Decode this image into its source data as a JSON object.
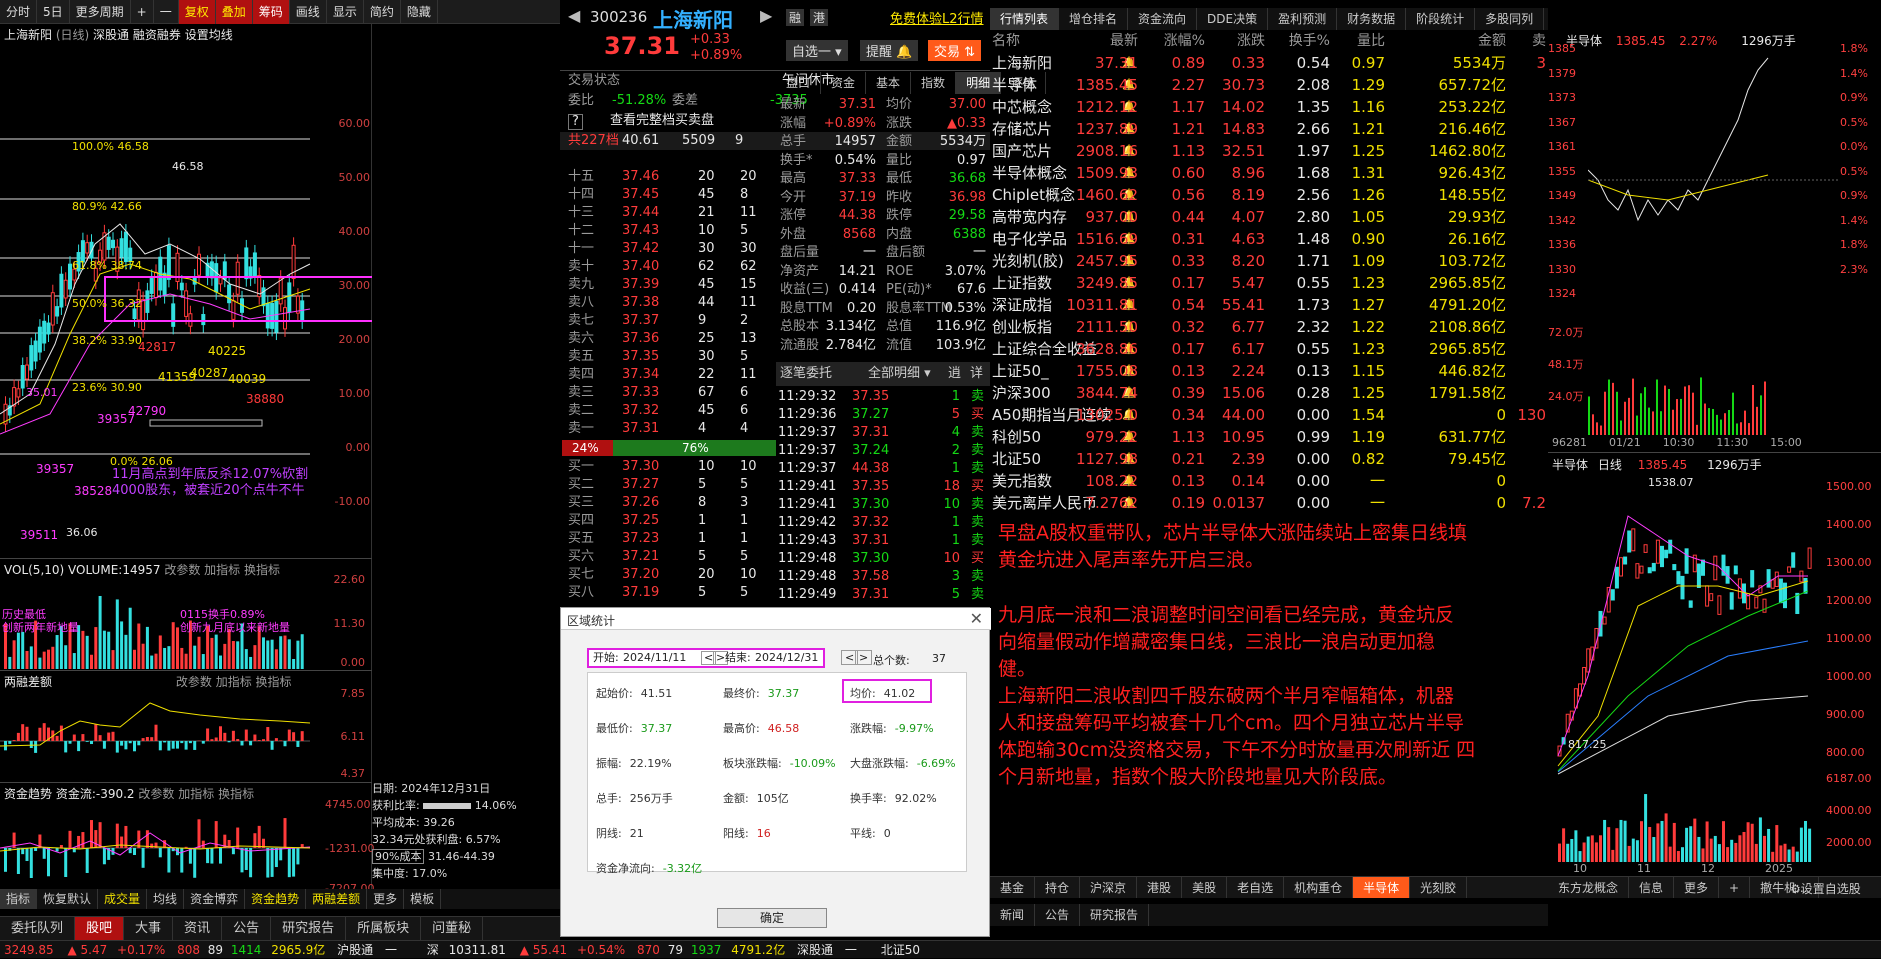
{
  "toolbar": {
    "items": [
      "分时",
      "5日",
      "更多周期",
      "+",
      "一",
      "复权",
      "叠加",
      "筹码",
      "画线",
      "显示",
      "简约",
      "隐藏"
    ]
  },
  "chart": {
    "stock_name": "上海新阳",
    "period": "(日线)",
    "tags": [
      "深股通",
      "融资融券",
      "设置均线"
    ],
    "price_axis": [
      "60.00",
      "50.00",
      "40.00",
      "30.00",
      "20.00",
      "10.00",
      "0.00",
      "-10.00"
    ],
    "fib": [
      "100.0% 46.58",
      "80.9% 42.66",
      "61.8% 38.74",
      "50.0% 36.32",
      "38.2% 33.90",
      "23.6% 30.90",
      "0.0% 26.06"
    ],
    "price_marks": [
      "46.58",
      "42817",
      "40225",
      "41359",
      "40287",
      "40039",
      "38880",
      "42790",
      "39357",
      "38528",
      "39357",
      "39511",
      "35.01",
      "36.06"
    ],
    "annotation": [
      "11月高点到年底反杀12.07%砍割",
      "4000股东，被套近20个点牛不牛"
    ],
    "x_axis": [
      "09",
      "10",
      "11",
      "12",
      "2025"
    ],
    "vol_header": "VOL(5,10)  VOLUME:14957",
    "vol_axis": [
      "22.60",
      "11.30",
      "0.00"
    ],
    "vol_notes": [
      "历史最低",
      "创新两年新地量",
      "0115换手0.89%",
      "创新九月底以来新地量"
    ],
    "margin_header": "两融差额",
    "margin_axis": [
      "7.85",
      "6.11",
      "4.37"
    ],
    "fund_header": "资金趋势  资金流:-390.2",
    "fund_axis": [
      "4745.00",
      "-1231.00",
      "-7207.00"
    ],
    "pane_btns": [
      "改参数",
      "加指标",
      "换指标"
    ],
    "chip": {
      "date": "日期: 2024年12月31日",
      "profit_ratio": "获利比率:",
      "profit_val": "14.06%",
      "avg_cost": "平均成本: 39.26",
      "profit_line": "32.34元处获利盘: 6.57%",
      "cost90": "90%成本",
      "cost90_range": "31.46-44.39",
      "concentration": "集中度: 17.0%"
    },
    "bottom_btns": [
      "指标",
      "恢复默认",
      "成交量",
      "均线",
      "资金博弈",
      "资金趋势",
      "两融差额",
      "更多",
      "模板"
    ]
  },
  "stock": {
    "code": "300236",
    "name": "上海新阳",
    "badges": [
      "融",
      "港"
    ],
    "l2": "免费体验L2行情",
    "price": "37.31",
    "change": "+0.33",
    "pct": "+0.89%",
    "btns": [
      "自选一",
      "提醒",
      "交易"
    ],
    "status_l": "交易状态",
    "status_r": "午间休市",
    "weibi": "委比",
    "weibi_v": "-51.28%",
    "weicha": "委差",
    "weicha_v": "-3735",
    "view_all": "查看完整档买卖盘",
    "total": "共227档",
    "total_p": "40.61",
    "total_v": "5509",
    "total_n": "9",
    "asks": [
      [
        "十五",
        "37.46",
        "20",
        "20"
      ],
      [
        "十四",
        "37.45",
        "45",
        "8"
      ],
      [
        "十三",
        "37.44",
        "21",
        "11"
      ],
      [
        "十二",
        "37.43",
        "10",
        "5"
      ],
      [
        "十一",
        "37.42",
        "30",
        "30"
      ],
      [
        "卖十",
        "37.40",
        "62",
        "62"
      ],
      [
        "卖九",
        "37.39",
        "45",
        "15"
      ],
      [
        "卖八",
        "37.38",
        "44",
        "11"
      ],
      [
        "卖七",
        "37.37",
        "9",
        "2"
      ],
      [
        "卖六",
        "37.36",
        "25",
        "13"
      ],
      [
        "卖五",
        "37.35",
        "30",
        "5"
      ],
      [
        "卖四",
        "37.34",
        "22",
        "11"
      ],
      [
        "卖三",
        "37.33",
        "67",
        "6"
      ],
      [
        "卖二",
        "37.32",
        "45",
        "6"
      ],
      [
        "卖一",
        "37.31",
        "4",
        "4"
      ]
    ],
    "bar_l": "24%",
    "bar_r": "76%",
    "bids": [
      [
        "买一",
        "37.30",
        "10",
        "10"
      ],
      [
        "买二",
        "37.27",
        "5",
        "5"
      ],
      [
        "买三",
        "37.26",
        "8",
        "3"
      ],
      [
        "买四",
        "37.25",
        "1",
        "1"
      ],
      [
        "买五",
        "37.23",
        "1",
        "1"
      ],
      [
        "买六",
        "37.21",
        "5",
        "5"
      ],
      [
        "买七",
        "37.20",
        "20",
        "10"
      ],
      [
        "买八",
        "37.19",
        "5",
        "5"
      ]
    ],
    "tabs": [
      "盘口",
      "资金",
      "基本",
      "指数",
      "明细",
      "逐笔"
    ],
    "quote": [
      [
        "最新",
        "37.31",
        "均价",
        "37.00"
      ],
      [
        "涨幅",
        "+0.89%",
        "涨跌",
        "▲0.33"
      ],
      [
        "总手",
        "14957",
        "金额",
        "5534万"
      ],
      [
        "换手*",
        "0.54%",
        "量比",
        "0.97"
      ],
      [
        "最高",
        "37.33",
        "最低",
        "36.68"
      ],
      [
        "今开",
        "37.19",
        "昨收",
        "36.98"
      ],
      [
        "涨停",
        "44.38",
        "跌停",
        "29.58"
      ],
      [
        "外盘",
        "8568",
        "内盘",
        "6388"
      ],
      [
        "盘后量",
        "一",
        "盘后额",
        "一"
      ],
      [
        "净资产",
        "14.21",
        "ROE",
        "3.07%"
      ],
      [
        "收益(三)",
        "0.414",
        "PE(动)*",
        "67.6"
      ],
      [
        "股息TTM",
        "0.20",
        "股息率TTM",
        "0.53%"
      ],
      [
        "总股本",
        "3.134亿",
        "总值",
        "116.9亿"
      ],
      [
        "流通股",
        "2.784亿",
        "流值",
        "103.9亿"
      ]
    ],
    "ticks_hdr": [
      "逐笔委托",
      "全部明细",
      "逍",
      "详"
    ],
    "ticks": [
      [
        "11:29:32",
        "37.35",
        "1",
        "卖"
      ],
      [
        "11:29:36",
        "37.27",
        "5",
        "买"
      ],
      [
        "11:29:37",
        "37.31",
        "4",
        "卖"
      ],
      [
        "11:29:37",
        "37.24",
        "2",
        "卖"
      ],
      [
        "11:29:37",
        "44.38",
        "1",
        "卖"
      ],
      [
        "11:29:41",
        "37.35",
        "18",
        "买"
      ],
      [
        "11:29:41",
        "37.30",
        "10",
        "卖"
      ],
      [
        "11:29:42",
        "37.32",
        "1",
        "卖"
      ],
      [
        "11:29:43",
        "37.31",
        "1",
        "卖"
      ],
      [
        "11:29:48",
        "37.30",
        "10",
        "买"
      ],
      [
        "11:29:48",
        "37.58",
        "3",
        "卖"
      ],
      [
        "11:29:49",
        "37.31",
        "5",
        "卖"
      ]
    ]
  },
  "dialog": {
    "title": "区域统计",
    "start_l": "开始:",
    "start": "2024/11/11",
    "end_l": "结束:",
    "end": "2024/12/31",
    "count_l": "总个数:",
    "count": "37",
    "cells": [
      [
        "起始价:",
        "41.51"
      ],
      [
        "最终价:",
        "37.37"
      ],
      [
        "均价:",
        "41.02"
      ],
      [
        "最低价:",
        "37.37"
      ],
      [
        "最高价:",
        "46.58"
      ],
      [
        "涨跌幅:",
        "-9.97%"
      ],
      [
        "振幅:",
        "22.19%"
      ],
      [
        "板块涨跌幅:",
        "-10.09%"
      ],
      [
        "大盘涨跌幅:",
        "-6.69%"
      ],
      [
        "总手:",
        "256万手"
      ],
      [
        "金额:",
        "105亿"
      ],
      [
        "换手率:",
        "92.02%"
      ],
      [
        "阴线:",
        "21"
      ],
      [
        "阳线:",
        "16"
      ],
      [
        "平线:",
        "0"
      ],
      [
        "资金净流向:",
        "-3.32亿"
      ]
    ],
    "ok": "确定"
  },
  "market": {
    "tabs": [
      "行情列表",
      "增仓排名",
      "资金流向",
      "DDE决策",
      "盈利预测",
      "财务数据",
      "阶段统计",
      "多股同列"
    ],
    "cols": [
      "名称",
      "最新",
      "涨幅%",
      "涨跌",
      "换手%",
      "量比",
      "金额",
      "卖"
    ],
    "rows": [
      [
        "上海新阳",
        "37.31",
        "0.89",
        "0.33",
        "0.54",
        "0.97",
        "5534万",
        "3"
      ],
      [
        "半导体",
        "1385.45",
        "2.27",
        "30.73",
        "2.08",
        "1.29",
        "657.72亿",
        ""
      ],
      [
        "中芯概念",
        "1212.12",
        "1.17",
        "14.02",
        "1.35",
        "1.16",
        "253.22亿",
        ""
      ],
      [
        "存储芯片",
        "1237.89",
        "1.21",
        "14.83",
        "2.66",
        "1.21",
        "216.46亿",
        ""
      ],
      [
        "国产芯片",
        "2908.16",
        "1.13",
        "32.51",
        "1.97",
        "1.25",
        "1462.80亿",
        ""
      ],
      [
        "半导体概念",
        "1509.93",
        "0.60",
        "8.96",
        "1.68",
        "1.31",
        "926.43亿",
        ""
      ],
      [
        "Chiplet概念",
        "1460.62",
        "0.56",
        "8.19",
        "2.56",
        "1.26",
        "148.55亿",
        ""
      ],
      [
        "高带宽内存",
        "937.00",
        "0.44",
        "4.07",
        "2.80",
        "1.05",
        "29.93亿",
        ""
      ],
      [
        "电子化学品",
        "1516.69",
        "0.31",
        "4.63",
        "1.48",
        "0.90",
        "26.16亿",
        ""
      ],
      [
        "光刻机(胶)",
        "2457.95",
        "0.33",
        "8.20",
        "1.71",
        "1.09",
        "103.72亿",
        ""
      ],
      [
        "上证指数",
        "3249.85",
        "0.17",
        "5.47",
        "0.55",
        "1.23",
        "2965.85亿",
        ""
      ],
      [
        "深证成指",
        "10311.81",
        "0.54",
        "55.41",
        "1.73",
        "1.27",
        "4791.20亿",
        ""
      ],
      [
        "创业板指",
        "2111.50",
        "0.32",
        "6.77",
        "2.32",
        "1.22",
        "2108.86亿",
        ""
      ],
      [
        "上证综合全收益",
        "3628.86",
        "0.17",
        "6.17",
        "0.55",
        "1.23",
        "2965.85亿",
        ""
      ],
      [
        "上证50_",
        "1755.08",
        "0.13",
        "2.24",
        "0.13",
        "1.15",
        "446.82亿",
        ""
      ],
      [
        "沪深300",
        "3844.74",
        "0.39",
        "15.06",
        "0.28",
        "1.25",
        "1791.58亿",
        ""
      ],
      [
        "A50期指当月连续",
        "13025.0",
        "0.34",
        "44.00",
        "0.00",
        "1.54",
        "0",
        "130"
      ],
      [
        "科创50",
        "979.22",
        "1.13",
        "10.95",
        "0.99",
        "1.19",
        "631.77亿",
        ""
      ],
      [
        "北证50",
        "1127.98",
        "0.21",
        "2.39",
        "0.00",
        "0.82",
        "79.45亿",
        ""
      ],
      [
        "美元指数",
        "108.22",
        "0.13",
        "0.14",
        "0.00",
        "一",
        "0",
        ""
      ],
      [
        "美元离岸人民币",
        "7.2762",
        "0.19",
        "0.0137",
        "0.00",
        "一",
        "0",
        "7.2"
      ]
    ],
    "note1": [
      "早盘A股权重带队，芯片半导体大涨陆续站上密集日线填",
      "黄金坑进入尾声率先开启三浪。"
    ],
    "note2": [
      "九月底一浪和二浪调整时间空间看已经完成，黄金坑反",
      "向缩量假动作增藏密集日线，三浪比一浪启动更加稳",
      "健。",
      "上海新阳二浪收割四千股东破两个半月窄幅箱体，机器",
      "人和接盘筹码平均被套十几个cm。四个月独立芯片半导",
      "体跑输30cm没资格交易，下午不分时放量再次刷新近 四",
      "个月新地量，指数个股大阶段地量见大阶段底。"
    ],
    "bottom_tabs": [
      "基金",
      "持仓",
      "沪深京",
      "港股",
      "美股",
      "老自选",
      "机构重仓",
      "半导体",
      "光刻胶",
      "东方龙概念",
      "信息",
      "更多",
      "+",
      "撤牛机..."
    ],
    "settings": "设置自选股",
    "news_tabs": [
      "新闻",
      "公告",
      "研究报告"
    ]
  },
  "right": {
    "top_hdr": [
      "半导体",
      "1385.45",
      "2.27%",
      "1296万手"
    ],
    "top_axis_l": [
      "1385",
      "1379",
      "1373",
      "1367",
      "1361",
      "1355",
      "1349",
      "1342",
      "1336",
      "1330",
      "1324"
    ],
    "top_axis_r": [
      "1.8%",
      "1.4%",
      "0.9%",
      "0.5%",
      "0.0%",
      "0.5%",
      "0.9%",
      "1.4%",
      "1.8%",
      "2.3%"
    ],
    "vol_axis": [
      "72.0万",
      "48.1万",
      "24.0万"
    ],
    "time_axis": [
      "96281",
      "01/21",
      "10:30",
      "11:30",
      "15:00"
    ],
    "k_hdr": [
      "半导体",
      "日线",
      "1385.45",
      "1296万手"
    ],
    "k_axis": [
      "1500.00",
      "1400.00",
      "1300.00",
      "1200.00",
      "1100.00",
      "1000.00",
      "900.00",
      "800.00"
    ],
    "k_marks": [
      "1538.07",
      "817.25"
    ],
    "kvol_axis": [
      "6187.00",
      "4000.00",
      "2000.00"
    ],
    "k_time": [
      "10",
      "11",
      "12",
      "2025"
    ]
  },
  "bottom": {
    "tabs": [
      "委托队列",
      "股吧",
      "大事",
      "资讯",
      "公告",
      "研究报告",
      "所属板块",
      "问董秘"
    ]
  },
  "status": [
    "3249.85",
    "▲ 5.47",
    "+0.17%",
    "808",
    "89",
    "1414",
    "2965.9亿",
    "沪股通",
    "一",
    "深",
    "10311.81",
    "▲ 55.41",
    "+0.54%",
    "870",
    "79",
    "1937",
    "4791.2亿",
    "深股通",
    "一",
    "北证50"
  ]
}
